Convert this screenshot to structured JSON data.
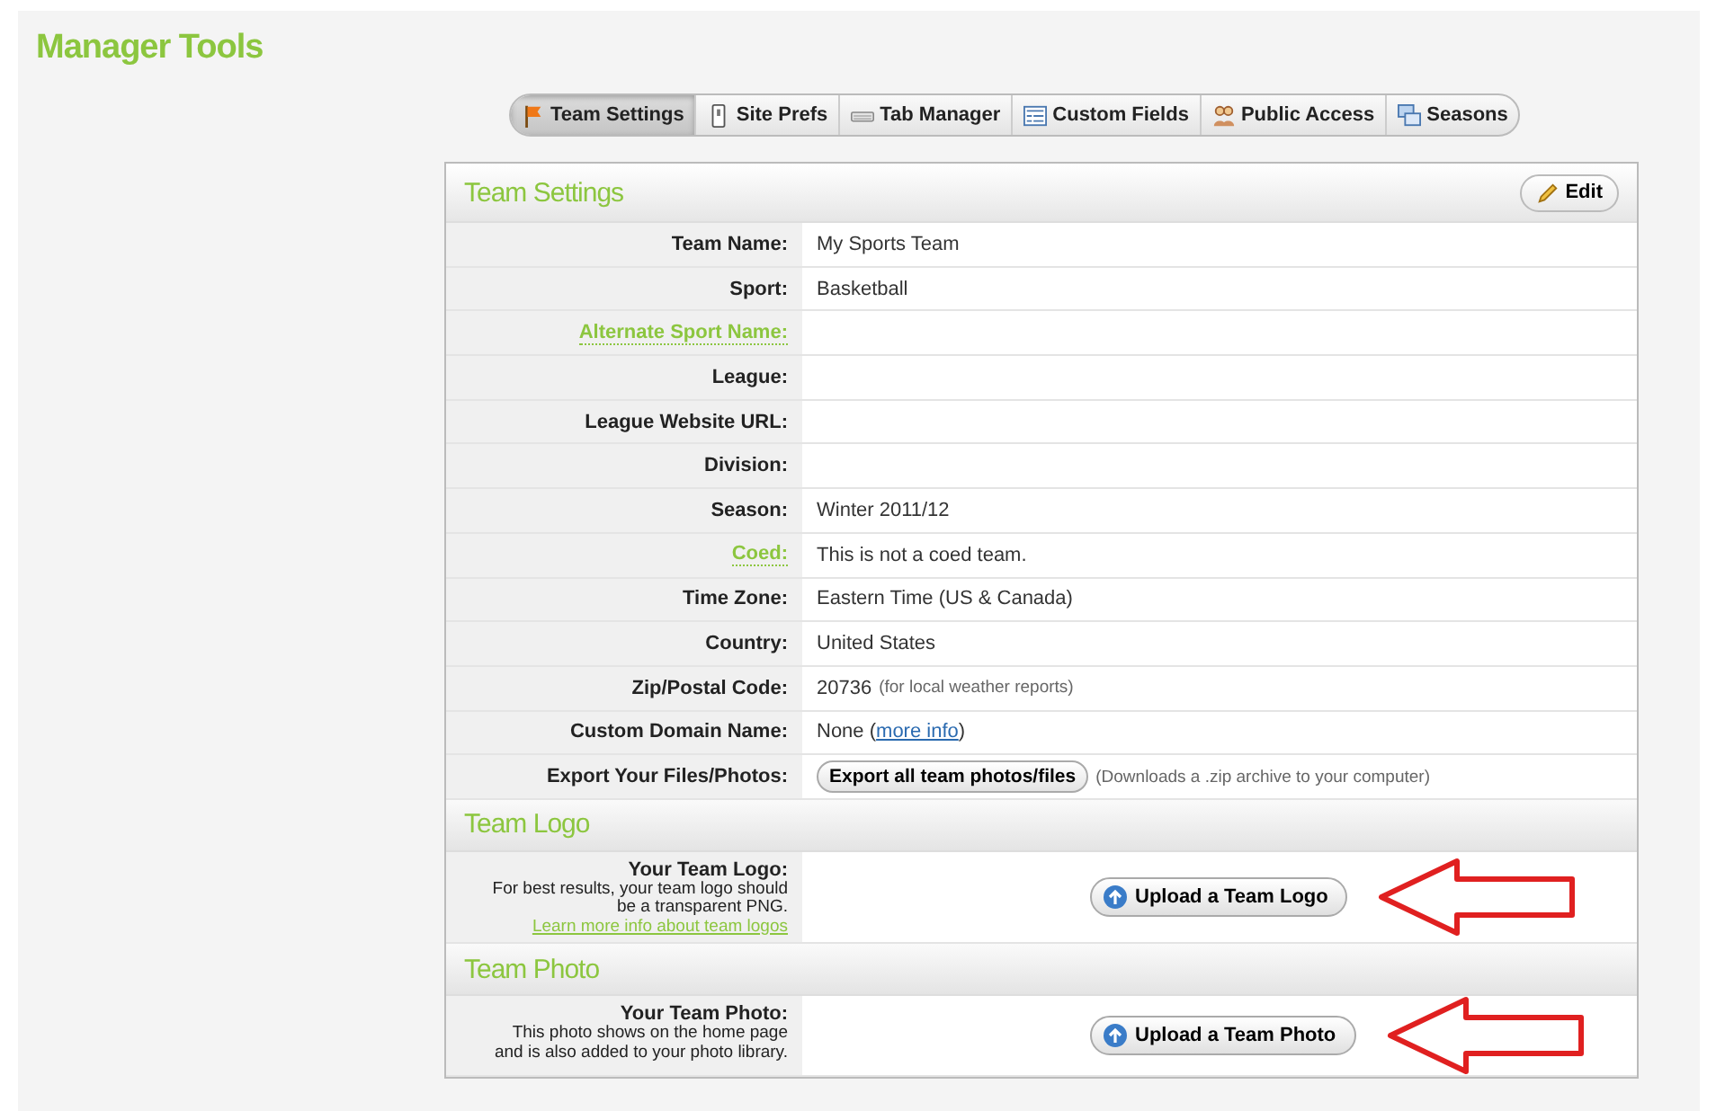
{
  "page_title": "Manager Tools",
  "tabs": [
    {
      "label": "Team Settings",
      "selected": true
    },
    {
      "label": "Site Prefs",
      "selected": false
    },
    {
      "label": "Tab Manager",
      "selected": false
    },
    {
      "label": "Custom Fields",
      "selected": false
    },
    {
      "label": "Public Access",
      "selected": false
    },
    {
      "label": "Seasons",
      "selected": false
    }
  ],
  "settings": {
    "title": "Team Settings",
    "edit_button": "Edit",
    "rows": [
      {
        "label": "Team Name:",
        "help": false,
        "kind": "text",
        "value": "My Sports Team"
      },
      {
        "label": "Sport:",
        "help": false,
        "kind": "text",
        "value": "Basketball"
      },
      {
        "label": "Alternate Sport Name:",
        "help": true,
        "kind": "empty"
      },
      {
        "label": "League:",
        "help": false,
        "kind": "empty"
      },
      {
        "label": "League Website URL:",
        "help": false,
        "kind": "empty"
      },
      {
        "label": "Division:",
        "help": false,
        "kind": "empty"
      },
      {
        "label": "Season:",
        "help": false,
        "kind": "text",
        "value": "Winter 2011/12"
      },
      {
        "label": "Coed:",
        "help": true,
        "kind": "text",
        "value": "This is not a coed team."
      },
      {
        "label": "Time Zone:",
        "help": false,
        "kind": "text",
        "value": "Eastern Time (US & Canada)"
      },
      {
        "label": "Country:",
        "help": false,
        "kind": "text",
        "value": "United States"
      },
      {
        "label": "Zip/Postal Code:",
        "help": false,
        "kind": "text",
        "value": "20736",
        "note": "(for local weather reports)"
      },
      {
        "label": "Custom Domain Name:",
        "help": false,
        "kind": "link",
        "value": "None (",
        "link": "more info",
        "after": ")"
      },
      {
        "label": "Export Your Files/Photos:",
        "help": false,
        "kind": "button",
        "button": "Export all team photos/files",
        "note": "(Downloads a .zip archive to your computer)"
      }
    ]
  },
  "sections": [
    {
      "title": "Team Logo",
      "label": "Your Team Logo:",
      "description": "For best results, your team logo should be a transparent PNG.",
      "link": "Learn more info about team logos",
      "button": "Upload a Team Logo"
    },
    {
      "title": "Team Photo",
      "label": "Your Team Photo:",
      "description": "This photo shows on the home page and is also added to your photo library.",
      "button": "Upload a Team Photo"
    }
  ]
}
